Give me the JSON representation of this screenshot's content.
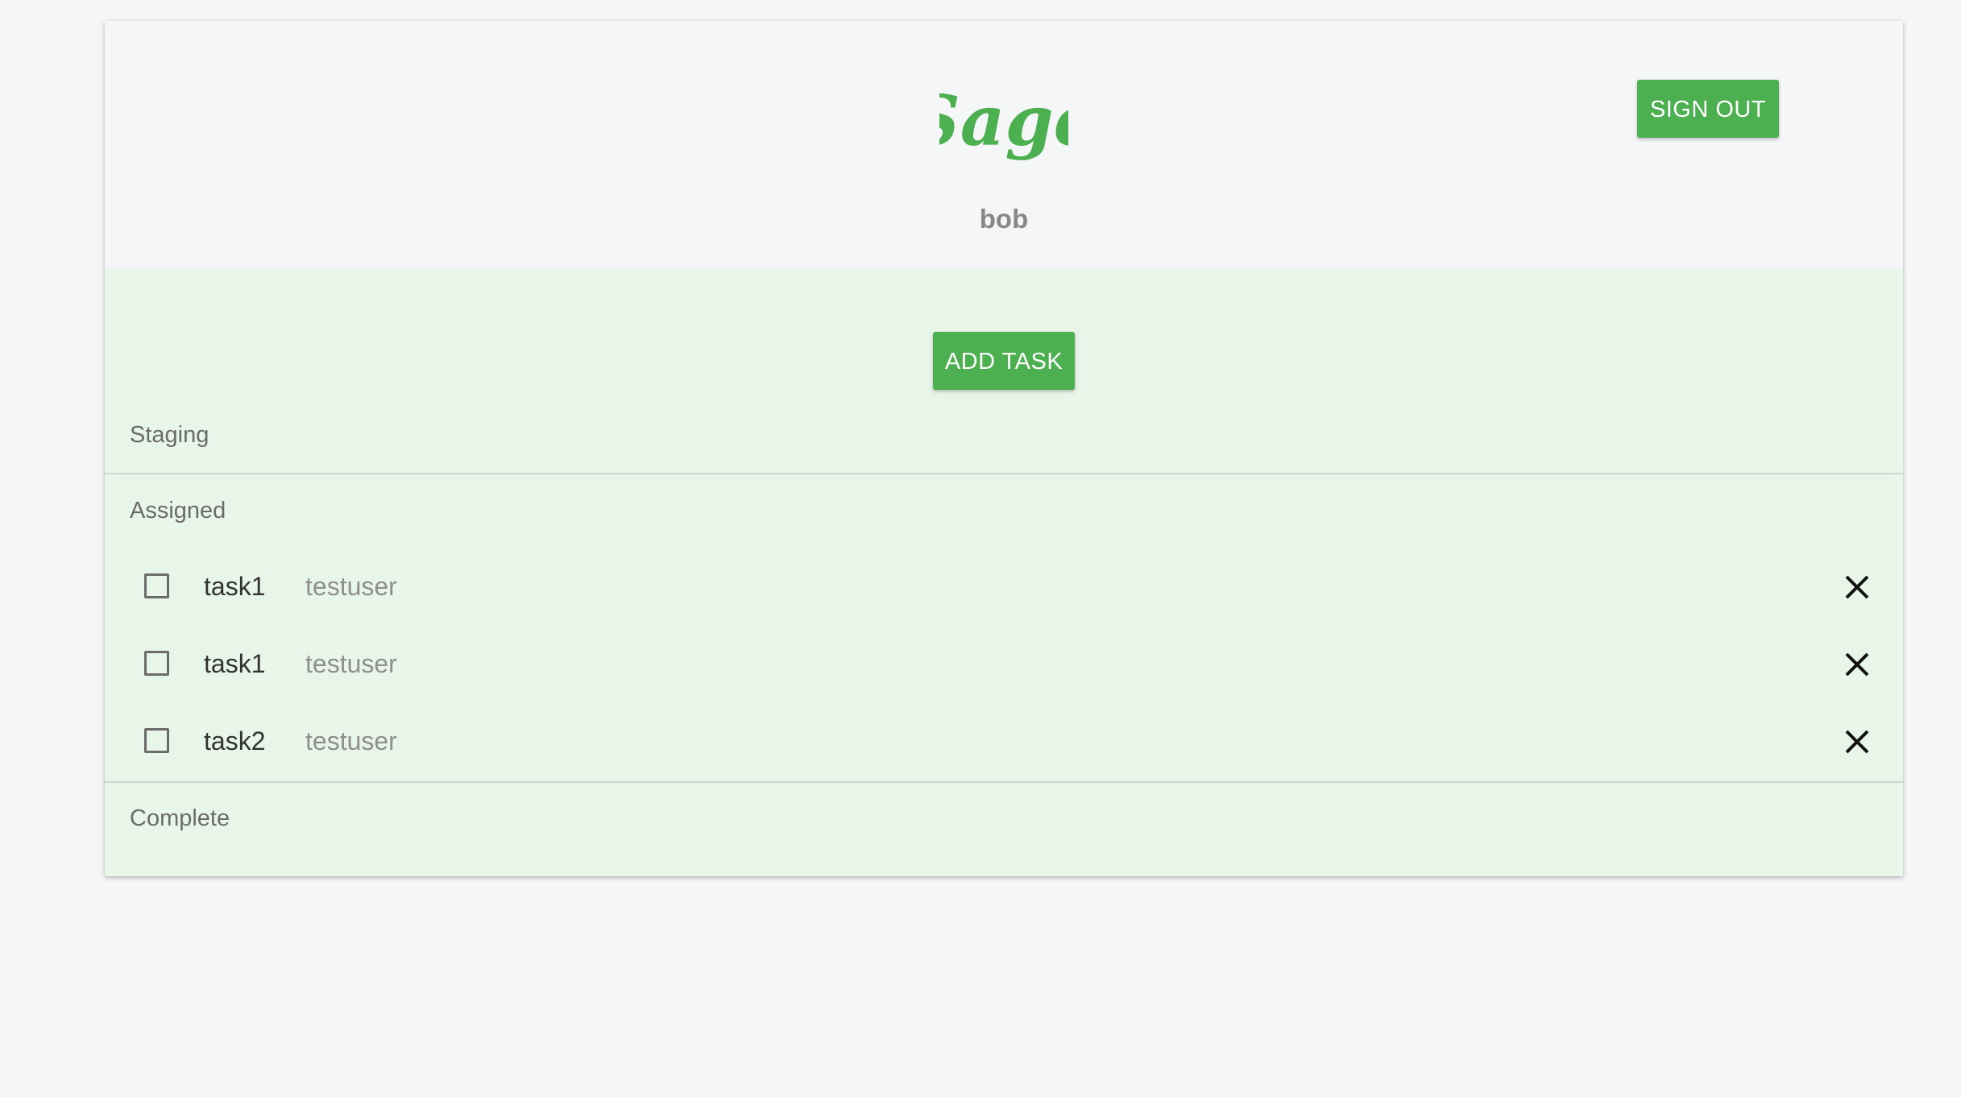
{
  "app": {
    "logo_text": "Sage",
    "username": "bob",
    "sign_out_label": "SIGN OUT",
    "add_task_label": "ADD TASK"
  },
  "colors": {
    "brand_green": "#4caf50",
    "content_bg": "#e8f5e9",
    "page_bg": "#f5f6f8"
  },
  "sections": {
    "staging": {
      "label": "Staging"
    },
    "assigned": {
      "label": "Assigned",
      "tasks": [
        {
          "name": "task1",
          "assignee": "testuser",
          "checked": false
        },
        {
          "name": "task1",
          "assignee": "testuser",
          "checked": false
        },
        {
          "name": "task2",
          "assignee": "testuser",
          "checked": false
        }
      ]
    },
    "complete": {
      "label": "Complete"
    }
  },
  "icons": {
    "checkbox": "checkbox-unchecked-icon",
    "delete": "close-icon"
  }
}
